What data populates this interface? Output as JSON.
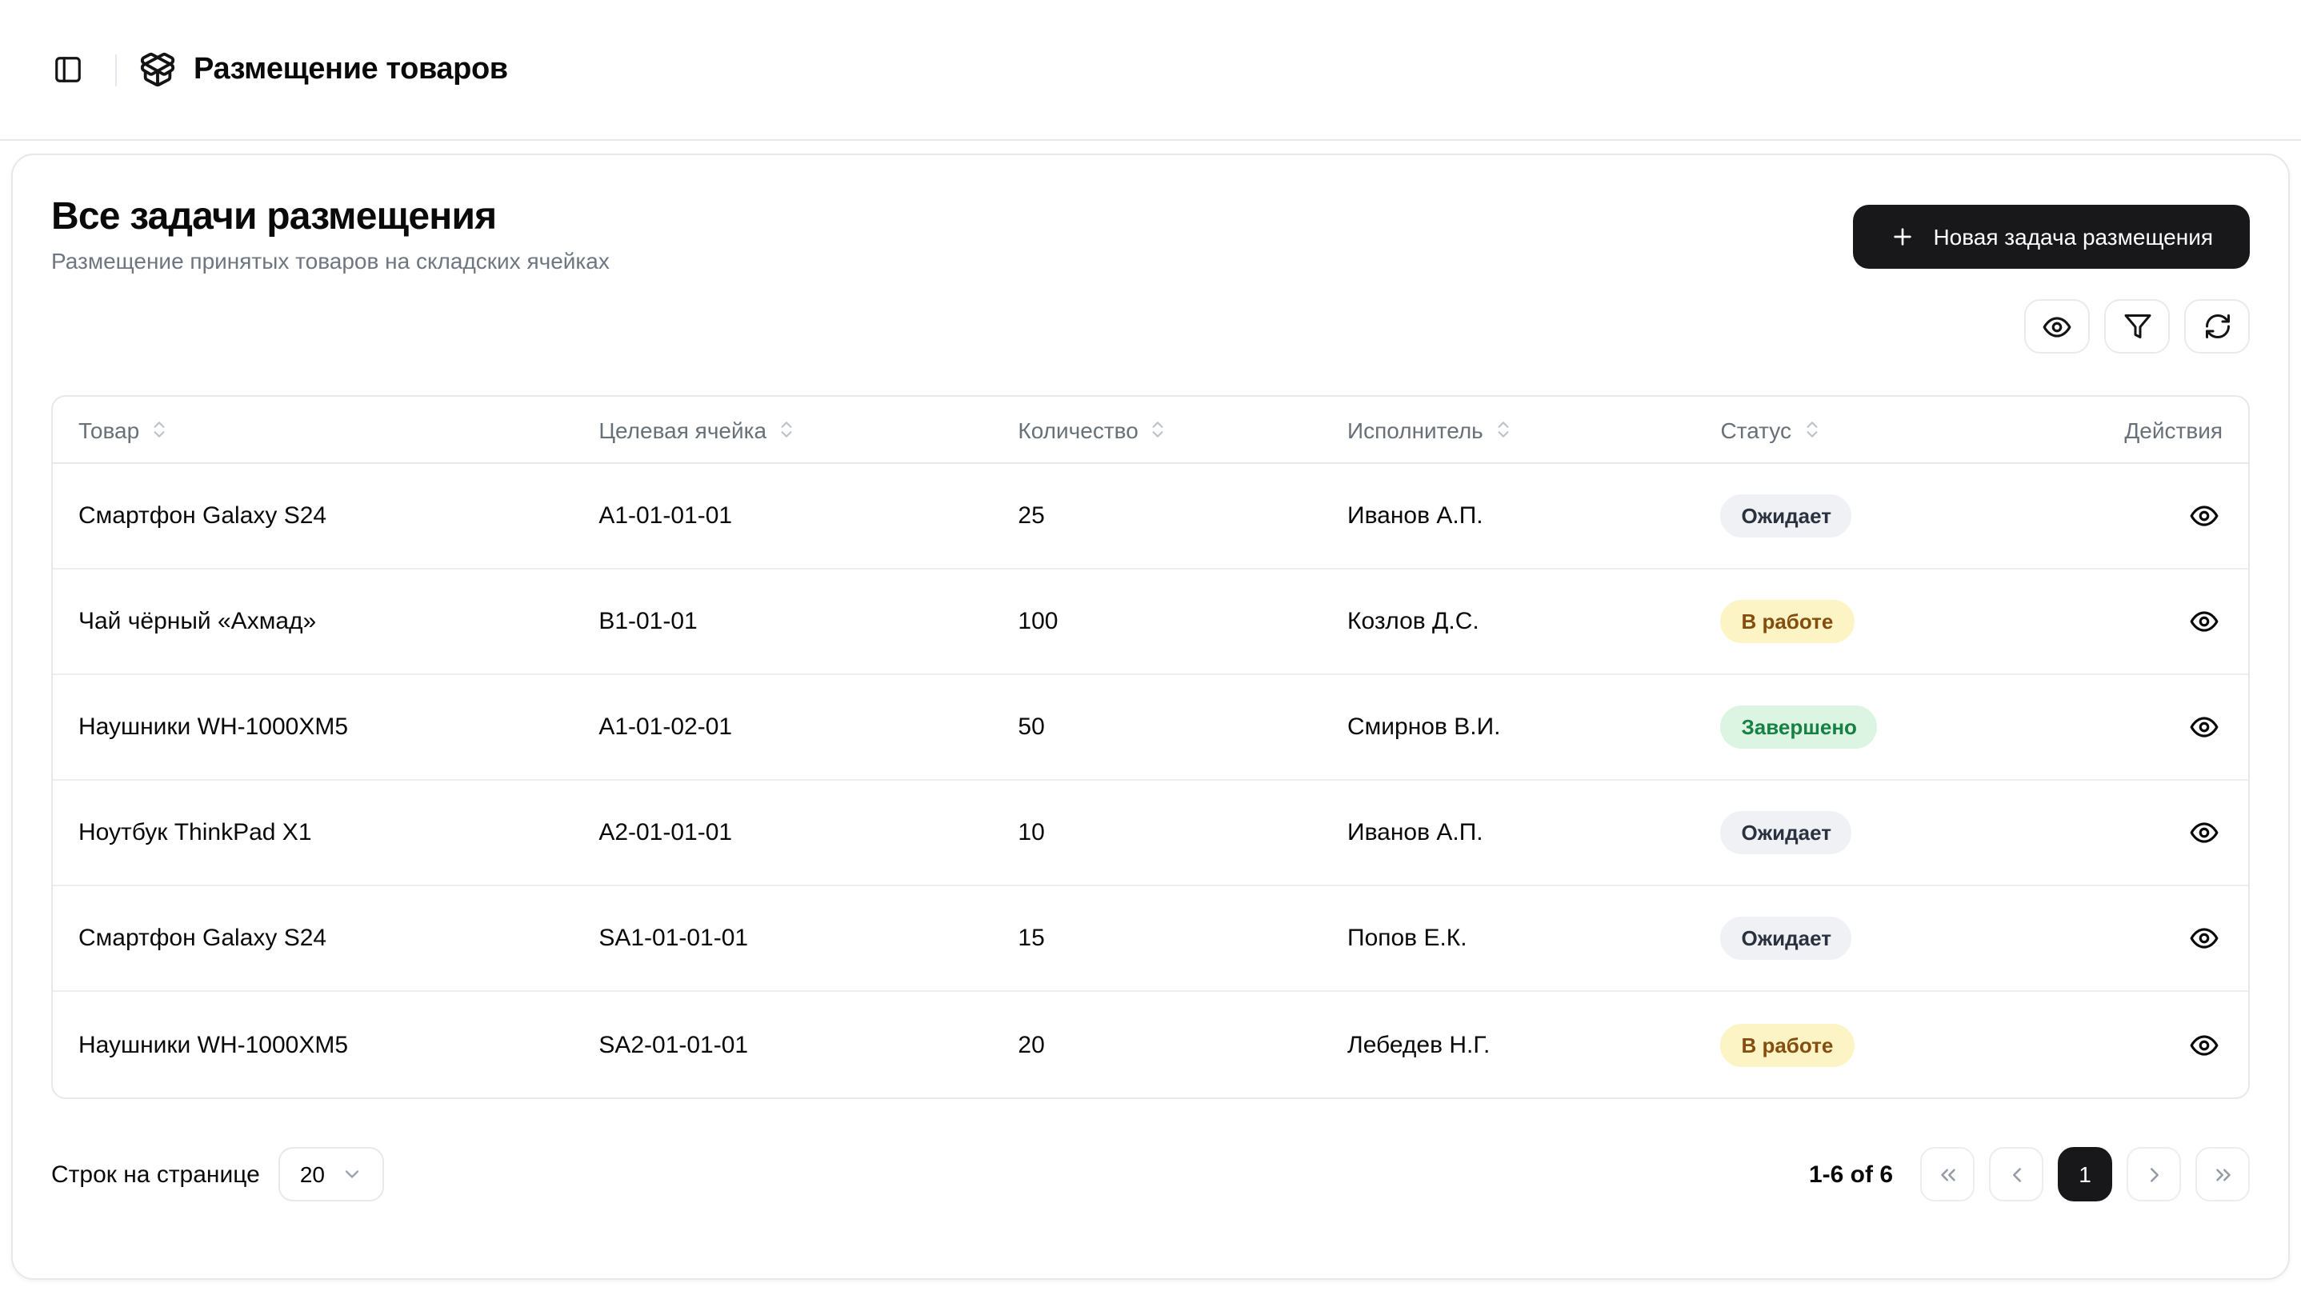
{
  "appbar": {
    "title": "Размещение товаров",
    "icons": [
      "panel-left-icon",
      "package-open-icon"
    ]
  },
  "card": {
    "title": "Все задачи размещения",
    "subtitle": "Размещение принятых товаров на складских ячейках",
    "new_task_button": "Новая задача размещения",
    "toolbar_icons": [
      "eye-icon",
      "filter-icon",
      "refresh-icon"
    ]
  },
  "table": {
    "columns": [
      {
        "label": "Товар",
        "sortable": true
      },
      {
        "label": "Целевая ячейка",
        "sortable": true
      },
      {
        "label": "Количество",
        "sortable": true
      },
      {
        "label": "Исполнитель",
        "sortable": true
      },
      {
        "label": "Статус",
        "sortable": true
      },
      {
        "label": "Действия",
        "sortable": false
      }
    ],
    "rows": [
      {
        "product": "Смартфон Galaxy S24",
        "cell": "A1-01-01-01",
        "quantity": "25",
        "executor": "Иванов А.П.",
        "status": "Ожидает",
        "status_kind": "pending"
      },
      {
        "product": "Чай чёрный «Ахмад»",
        "cell": "B1-01-01",
        "quantity": "100",
        "executor": "Козлов Д.С.",
        "status": "В работе",
        "status_kind": "in-progress"
      },
      {
        "product": "Наушники WH-1000XM5",
        "cell": "A1-01-02-01",
        "quantity": "50",
        "executor": "Смирнов В.И.",
        "status": "Завершено",
        "status_kind": "done"
      },
      {
        "product": "Ноутбук ThinkPad X1",
        "cell": "A2-01-01-01",
        "quantity": "10",
        "executor": "Иванов А.П.",
        "status": "Ожидает",
        "status_kind": "pending"
      },
      {
        "product": "Смартфон Galaxy S24",
        "cell": "SA1-01-01-01",
        "quantity": "15",
        "executor": "Попов Е.К.",
        "status": "Ожидает",
        "status_kind": "pending"
      },
      {
        "product": "Наушники WH-1000XM5",
        "cell": "SA2-01-01-01",
        "quantity": "20",
        "executor": "Лебедев Н.Г.",
        "status": "В работе",
        "status_kind": "in-progress"
      }
    ]
  },
  "pagination": {
    "rows_per_page_label": "Строк на странице",
    "rows_per_page_value": "20",
    "range_text": "1-6 of 6",
    "current_page": "1"
  },
  "colors": {
    "primary_button_bg": "#18181b",
    "status_pending_bg": "#eff1f4",
    "status_pending_text": "#2a323f",
    "status_in_progress_bg": "#fcf4c4",
    "status_in_progress_text": "#854d0e",
    "status_done_bg": "#dcf5e3",
    "status_done_text": "#178044",
    "border": "#e7e8ea",
    "muted_text": "#6f7680"
  }
}
